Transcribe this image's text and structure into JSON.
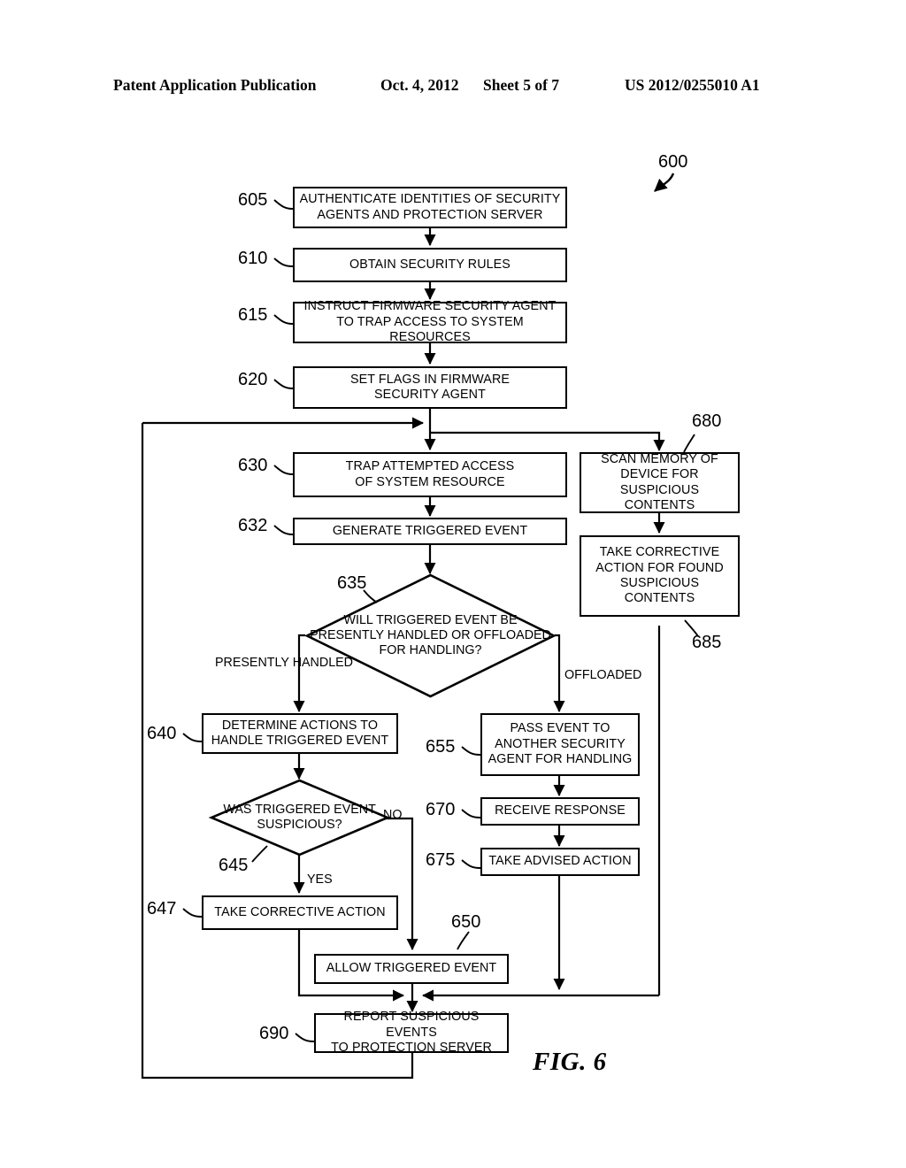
{
  "header": {
    "publication": "Patent Application Publication",
    "date": "Oct. 4, 2012",
    "sheet": "Sheet 5 of 7",
    "number": "US 2012/0255010 A1"
  },
  "figure": {
    "caption": "FIG. 6",
    "diagram_ref": "600"
  },
  "nodes": [
    {
      "id": "605",
      "ref": "605",
      "type": "process",
      "text": "AUTHENTICATE IDENTITIES OF SECURITY AGENTS AND PROTECTION SERVER"
    },
    {
      "id": "610",
      "ref": "610",
      "type": "process",
      "text": "OBTAIN SECURITY RULES"
    },
    {
      "id": "615",
      "ref": "615",
      "type": "process",
      "text": "INSTRUCT FIRMWARE SECURITY AGENT TO TRAP ACCESS TO SYSTEM RESOURCES"
    },
    {
      "id": "620",
      "ref": "620",
      "type": "process",
      "text": "SET FLAGS IN FIRMWARE SECURITY AGENT"
    },
    {
      "id": "630",
      "ref": "630",
      "type": "process",
      "text": "TRAP ATTEMPTED ACCESS OF SYSTEM RESOURCE"
    },
    {
      "id": "632",
      "ref": "632",
      "type": "process",
      "text": "GENERATE TRIGGERED EVENT"
    },
    {
      "id": "635",
      "ref": "635",
      "type": "decision",
      "text": "WILL TRIGGERED EVENT BE PRESENTLY HANDLED OR OFFLOADED FOR HANDLING?"
    },
    {
      "id": "640",
      "ref": "640",
      "type": "process",
      "text": "DETERMINE ACTIONS TO HANDLE TRIGGERED EVENT"
    },
    {
      "id": "645",
      "ref": "645",
      "type": "decision",
      "text": "WAS TRIGGERED EVENT SUSPICIOUS?"
    },
    {
      "id": "647",
      "ref": "647",
      "type": "process",
      "text": "TAKE CORRECTIVE ACTION"
    },
    {
      "id": "650",
      "ref": "650",
      "type": "process",
      "text": "ALLOW TRIGGERED EVENT"
    },
    {
      "id": "655",
      "ref": "655",
      "type": "process",
      "text": "PASS EVENT TO ANOTHER SECURITY AGENT FOR HANDLING"
    },
    {
      "id": "670",
      "ref": "670",
      "type": "process",
      "text": "RECEIVE RESPONSE"
    },
    {
      "id": "675",
      "ref": "675",
      "type": "process",
      "text": "TAKE ADVISED ACTION"
    },
    {
      "id": "680",
      "ref": "680",
      "type": "process",
      "text": "SCAN MEMORY OF DEVICE FOR SUSPICIOUS CONTENTS"
    },
    {
      "id": "685",
      "ref": "685",
      "type": "process",
      "text": "TAKE CORRECTIVE ACTION FOR FOUND SUSPICIOUS CONTENTS"
    },
    {
      "id": "690",
      "ref": "690",
      "type": "process",
      "text": "REPORT SUSPICIOUS EVENTS TO PROTECTION SERVER"
    }
  ],
  "edge_labels": {
    "presently_handled": "PRESENTLY\nHANDLED",
    "presently_handled_l1": "PRESENTLY",
    "presently_handled_l2": "HANDLED",
    "offloaded": "OFFLOADED",
    "yes": "YES",
    "no": "NO"
  },
  "box_text": {
    "n605_l1": "AUTHENTICATE IDENTITIES OF SECURITY",
    "n605_l2": "AGENTS AND PROTECTION SERVER",
    "n610_l1": "OBTAIN SECURITY RULES",
    "n615_l1": "INSTRUCT FIRMWARE SECURITY AGENT",
    "n615_l2": "TO TRAP ACCESS TO SYSTEM RESOURCES",
    "n620_l1": "SET FLAGS IN FIRMWARE",
    "n620_l2": "SECURITY AGENT",
    "n630_l1": "TRAP ATTEMPTED ACCESS",
    "n630_l2": "OF SYSTEM RESOURCE",
    "n632_l1": "GENERATE TRIGGERED EVENT",
    "n635_l1": "WILL",
    "n635_l2": "TRIGGERED EVENT",
    "n635_l3": "BE PRESENTLY HANDLED",
    "n635_l4": "OR OFFLOADED FOR",
    "n635_l5": "HANDLING?",
    "n640_l1": "DETERMINE ACTIONS TO",
    "n640_l2": "HANDLE TRIGGERED EVENT",
    "n645_l1": "WAS",
    "n645_l2": "TRIGGERED EVENT",
    "n645_l3": "SUSPICIOUS?",
    "n647_l1": "TAKE CORRECTIVE ACTION",
    "n650_l1": "ALLOW TRIGGERED EVENT",
    "n655_l1": "PASS EVENT TO",
    "n655_l2": "ANOTHER SECURITY",
    "n655_l3": "AGENT FOR HANDLING",
    "n670_l1": "RECEIVE RESPONSE",
    "n675_l1": "TAKE ADVISED ACTION",
    "n680_l1": "SCAN MEMORY OF",
    "n680_l2": "DEVICE FOR",
    "n680_l3": "SUSPICIOUS CONTENTS",
    "n685_l1": "TAKE CORRECTIVE",
    "n685_l2": "ACTION FOR FOUND",
    "n685_l3": "SUSPICIOUS",
    "n685_l4": "CONTENTS",
    "n690_l1": "REPORT SUSPICIOUS EVENTS",
    "n690_l2": "TO PROTECTION SERVER"
  },
  "refs": {
    "r600": "600",
    "r605": "605",
    "r610": "610",
    "r615": "615",
    "r620": "620",
    "r630": "630",
    "r632": "632",
    "r635": "635",
    "r640": "640",
    "r645": "645",
    "r647": "647",
    "r650": "650",
    "r655": "655",
    "r670": "670",
    "r675": "675",
    "r680": "680",
    "r685": "685",
    "r690": "690"
  },
  "colors": {
    "ink": "#000000",
    "paper": "#ffffff"
  }
}
